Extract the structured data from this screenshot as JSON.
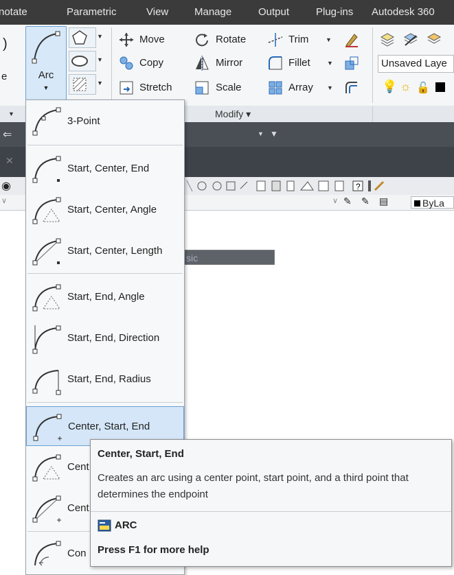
{
  "ribbon_tabs": [
    "notate",
    "Parametric",
    "View",
    "Manage",
    "Output",
    "Plug-ins",
    "Autodesk 360"
  ],
  "draw_panel": {
    "arc_label": "Arc",
    "left_fragment_1": ")",
    "left_fragment_2": "e"
  },
  "modify_panel": {
    "title": "Modify",
    "buttons": {
      "move": "Move",
      "rotate": "Rotate",
      "trim": "Trim",
      "copy": "Copy",
      "mirror": "Mirror",
      "fillet": "Fillet",
      "stretch": "Stretch",
      "scale": "Scale",
      "array": "Array"
    }
  },
  "layer_panel": {
    "layer_state": "Unsaved Laye"
  },
  "workspace_combo": "sic",
  "property_value": "ByLa",
  "arc_menu": {
    "items": [
      "3-Point",
      "Start, Center, End",
      "Start, Center, Angle",
      "Start, Center, Length",
      "Start, End, Angle",
      "Start, End, Direction",
      "Start, End, Radius",
      "Center, Start, End",
      "Cent",
      "Cent",
      "Con"
    ],
    "highlighted_index": 7
  },
  "tooltip": {
    "title": "Center, Start, End",
    "description": "Creates an arc using a center point, start point, and a third point that determines the endpoint",
    "command": "ARC",
    "help": "Press F1 for more help"
  },
  "colors": {
    "tabbar": "#3b3b3b",
    "highlight": "#d4e6f8",
    "highlight_border": "#6c9fd2"
  }
}
